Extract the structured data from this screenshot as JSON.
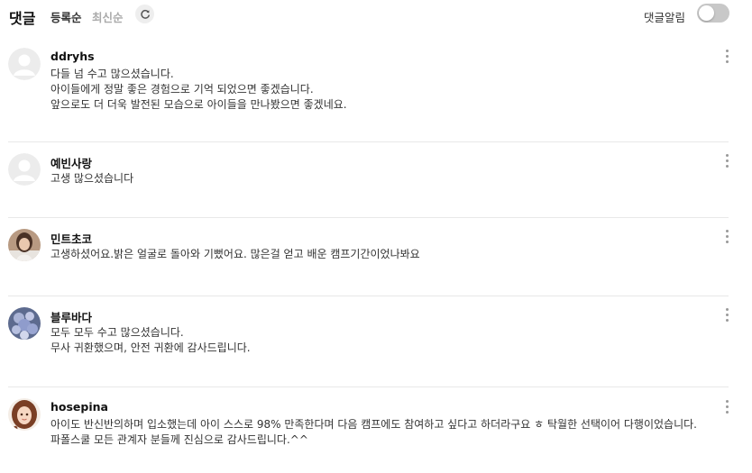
{
  "header": {
    "title": "댓글",
    "sort_registered": "등록순",
    "sort_latest": "최신순",
    "refresh_icon": "refresh-icon",
    "alarm_label": "댓글알림",
    "alarm_on": false
  },
  "comments": [
    {
      "author": "ddryhs",
      "avatar": "default-avatar",
      "lines": [
        "다들 넘 수고 많으셨습니다.",
        "아이들에게 정말 좋은 경험으로 기억 되었으면 좋겠습니다.",
        "앞으로도 더 더욱 발전된 모습으로 아이들을 만나봤으면 좋겠네요."
      ]
    },
    {
      "author": "예빈사랑",
      "avatar": "default-avatar",
      "lines": [
        "고생 많으셨습니다"
      ]
    },
    {
      "author": "민트초코",
      "avatar": "photo-avatar",
      "lines": [
        "고생하셨어요.밝은 얼굴로 돌아와 기뻤어요. 많은걸 얻고 배운 캠프기간이었나봐요"
      ]
    },
    {
      "author": "블루바다",
      "avatar": "flower-avatar",
      "lines": [
        "모두 모두 수고 많으셨습니다.",
        "무사 귀환했으며, 안전 귀환에 감사드립니다."
      ]
    },
    {
      "author": "hosepina",
      "avatar": "cartoon-avatar",
      "lines": [
        "아이도 반신반의하며 입소했는데 아이 스스로 98% 만족한다며 다음 캠프에도 참여하고 싶다고 하더라구요 ㅎ 탁월한 선택이어 다행이었습니다. 파폴스쿨 모든 관계자 분들께 진심으로 감사드립니다.^^"
      ]
    }
  ]
}
